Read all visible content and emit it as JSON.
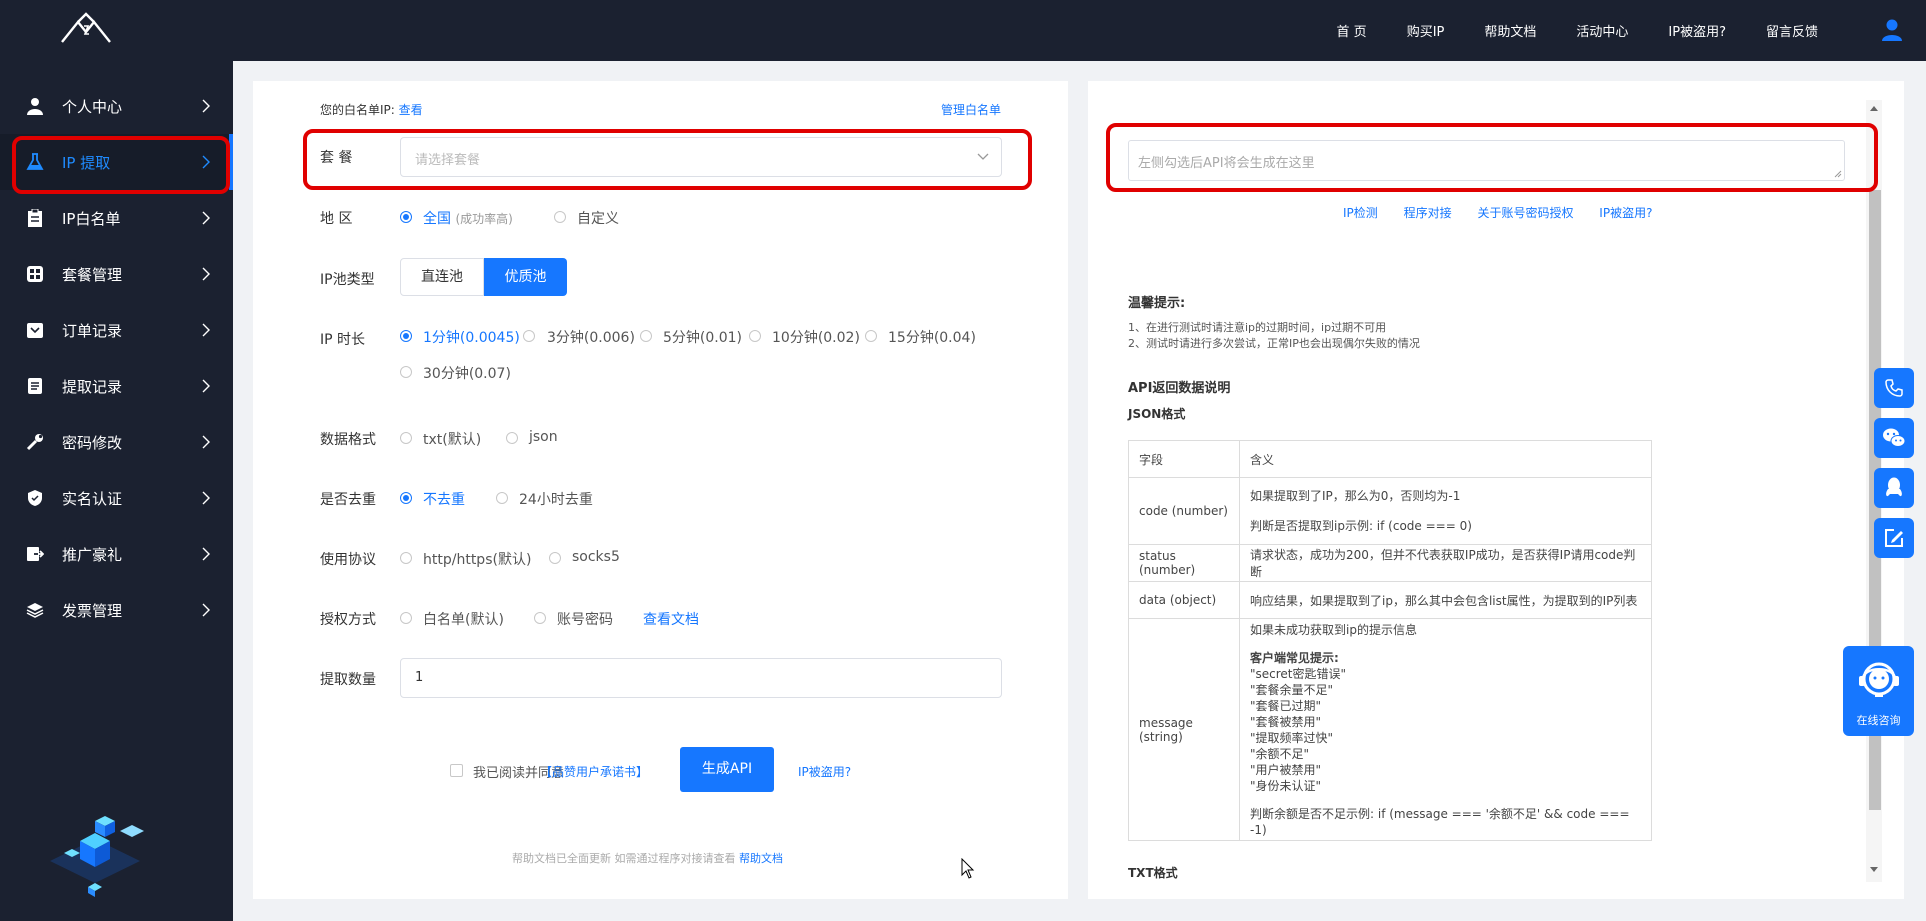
{
  "nav": {
    "items": [
      "首 页",
      "购买IP",
      "帮助文档",
      "活动中心",
      "IP被盗用?",
      "留言反馈"
    ]
  },
  "sidebar": {
    "items": [
      {
        "label": "个人中心",
        "icon": "user-icon"
      },
      {
        "label": "IP 提取",
        "icon": "flask-icon"
      },
      {
        "label": "IP白名单",
        "icon": "clipboard-icon"
      },
      {
        "label": "套餐管理",
        "icon": "grid-icon"
      },
      {
        "label": "订单记录",
        "icon": "order-icon"
      },
      {
        "label": "提取记录",
        "icon": "list-icon"
      },
      {
        "label": "密码修改",
        "icon": "wrench-icon"
      },
      {
        "label": "实名认证",
        "icon": "shield-icon"
      },
      {
        "label": "推广豪礼",
        "icon": "share-icon"
      },
      {
        "label": "发票管理",
        "icon": "layers-icon"
      }
    ],
    "active_index": 1
  },
  "form": {
    "whitelist_prefix": "您的白名单IP:",
    "whitelist_view": "查看",
    "manage_whitelist": "管理白名单",
    "package_label": "套 餐",
    "package_placeholder": "请选择套餐",
    "region_label": "地 区",
    "region_all": "全国",
    "region_all_note": "(成功率高)",
    "region_custom": "自定义",
    "pool_label": "IP池类型",
    "pool_direct": "直连池",
    "pool_premium": "优质池",
    "duration_label": "IP 时长",
    "durations": [
      "1分钟(0.0045)",
      "3分钟(0.006)",
      "5分钟(0.01)",
      "10分钟(0.02)",
      "15分钟(0.04)",
      "30分钟(0.07)"
    ],
    "format_label": "数据格式",
    "format_txt": "txt(默认)",
    "format_json": "json",
    "dedup_label": "是否去重",
    "dedup_no": "不去重",
    "dedup_24h": "24小时去重",
    "protocol_label": "使用协议",
    "protocol_http": "http/https(默认)",
    "protocol_socks5": "socks5",
    "auth_label": "授权方式",
    "auth_whitelist": "白名单(默认)",
    "auth_account": "账号密码",
    "auth_doc": "查看文档",
    "quantity_label": "提取数量",
    "quantity_value": "1",
    "agree_text": "我已阅读并同意",
    "agree_link": "【品赞用户承诺书】",
    "generate_button": "生成API",
    "stolen_link": "IP被盗用?",
    "footer_note": "帮助文档已全面更新 如需通过程序对接请查看",
    "footer_link": "帮助文档"
  },
  "right": {
    "api_placeholder": "左侧勾选后API将会生成在这里",
    "links": [
      "IP检测",
      "程序对接",
      "关于账号密码授权",
      "IP被盗用?"
    ],
    "tips_title": "温馨提示:",
    "tips": [
      "1、在进行测试时请注意ip的过期时间，ip过期不可用",
      "2、测试时请进行多次尝试，正常IP也会出现偶尔失败的情况"
    ],
    "api_desc_title": "API返回数据说明",
    "json_title": "JSON格式",
    "table_header": [
      "字段",
      "含义"
    ],
    "rows": [
      {
        "field": "code (number)",
        "lines": [
          "如果提取到了IP，那么为0，否则均为-1",
          "判断是否提取到ip示例: if (code === 0)"
        ]
      },
      {
        "field": "status (number)",
        "lines": [
          "请求状态，成功为200，但并不代表获取IP成功，是否获得IP请用code判断"
        ]
      },
      {
        "field": "data (object)",
        "lines": [
          "响应结果，如果提取到了ip，那么其中会包含list属性，为提取到的IP列表"
        ]
      },
      {
        "field": "message (string)",
        "lines": [
          "如果未成功获取到ip的提示信息",
          "客户端常见提示:",
          "\"secret密匙错误\"",
          "\"套餐余量不足\"",
          "\"套餐已过期\"",
          "\"套餐被禁用\"",
          "\"提取频率过快\"",
          "\"余额不足\"",
          "\"用户被禁用\"",
          "\"身份未认证\"",
          "判断余额是否不足示例: if (message === '余额不足' && code === -1)"
        ]
      }
    ],
    "txt_title": "TXT格式"
  },
  "floating": {
    "consult_label": "在线咨询"
  }
}
